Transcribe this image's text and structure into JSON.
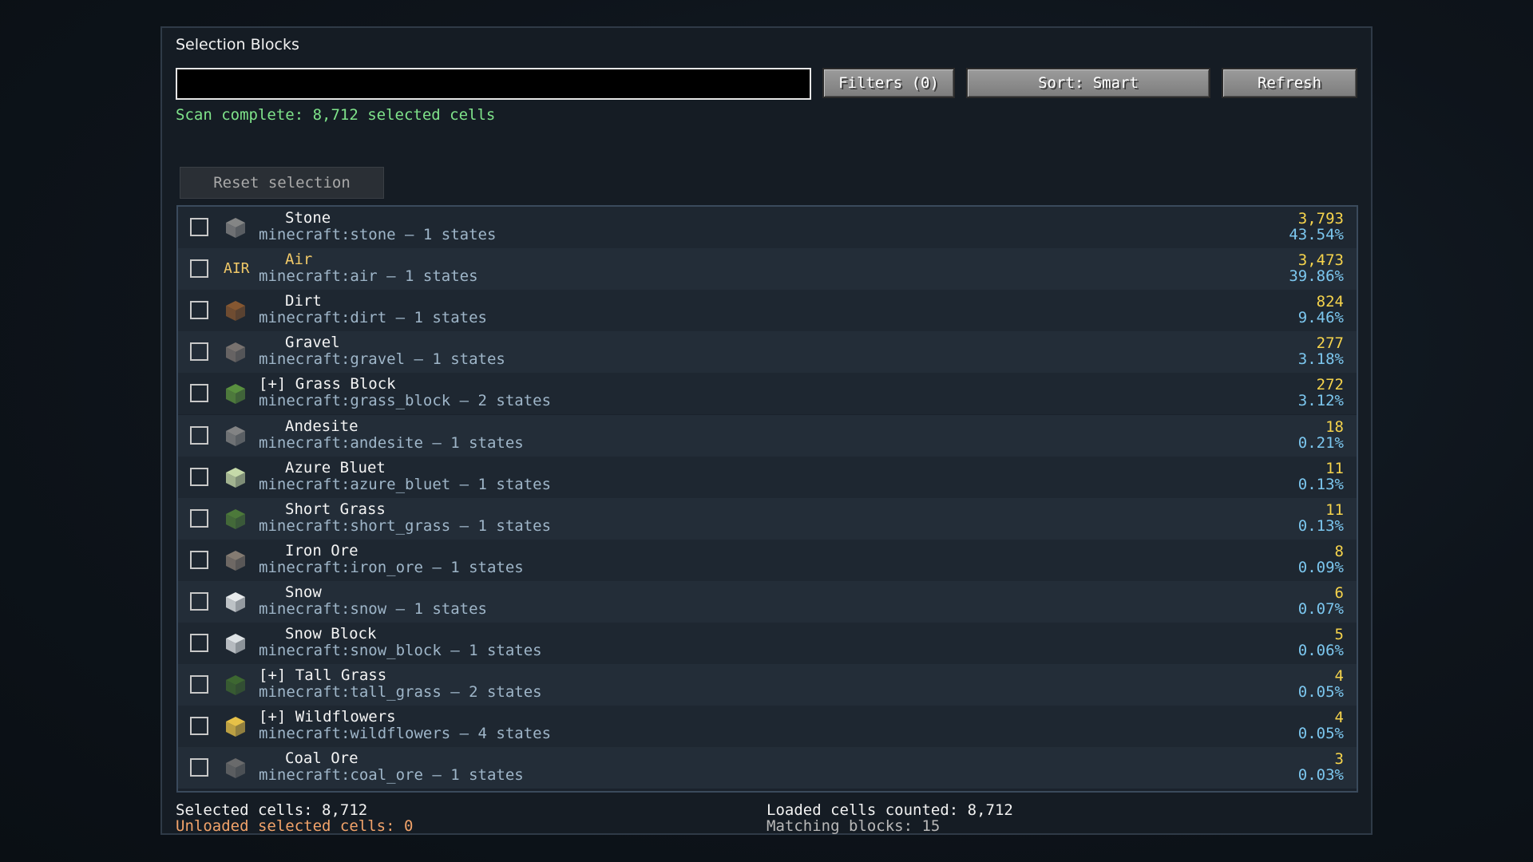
{
  "window": {
    "title": "Selection Blocks"
  },
  "search": {
    "value": "",
    "placeholder": ""
  },
  "toolbar": {
    "filters_label": "Filters (0)",
    "sort_label": "Sort: Smart",
    "refresh_label": "Refresh"
  },
  "status": {
    "text": "Scan complete: 8,712 selected cells"
  },
  "reset_label": "Reset selection",
  "rows": [
    {
      "name": "Stone",
      "sub": "minecraft:stone  –  1 states",
      "count": "3,793",
      "pct": "43.54%",
      "icon": "stone-icon",
      "color": "#8a8a8a"
    },
    {
      "name": "Air",
      "sub": "minecraft:air  –  1 states",
      "count": "3,473",
      "pct": "39.86%",
      "icon": "air-icon",
      "color": "#f1c968",
      "icon_text": "AIR"
    },
    {
      "name": "Dirt",
      "sub": "minecraft:dirt  –  1 states",
      "count": "824",
      "pct": "9.46%",
      "icon": "dirt-icon",
      "color": "#8b5a32"
    },
    {
      "name": "Gravel",
      "sub": "minecraft:gravel  –  1 states",
      "count": "277",
      "pct": "3.18%",
      "icon": "gravel-icon",
      "color": "#7d7672"
    },
    {
      "name": "[+] Grass Block",
      "sub": "minecraft:grass_block  –  2 states",
      "count": "272",
      "pct": "3.12%",
      "icon": "grass-block-icon",
      "color": "#5d9640"
    },
    {
      "name": "Andesite",
      "sub": "minecraft:andesite  –  1 states",
      "count": "18",
      "pct": "0.21%",
      "icon": "andesite-icon",
      "color": "#888888"
    },
    {
      "name": "Azure Bluet",
      "sub": "minecraft:azure_bluet  –  1 states",
      "count": "11",
      "pct": "0.13%",
      "icon": "azure-bluet-icon",
      "color": "#cfe3b0"
    },
    {
      "name": "Short Grass",
      "sub": "minecraft:short_grass  –  1 states",
      "count": "11",
      "pct": "0.13%",
      "icon": "short-grass-icon",
      "color": "#4f7d3a"
    },
    {
      "name": "Iron Ore",
      "sub": "minecraft:iron_ore  –  1 states",
      "count": "8",
      "pct": "0.09%",
      "icon": "iron-ore-icon",
      "color": "#8a7f76"
    },
    {
      "name": "Snow",
      "sub": "minecraft:snow  –  1 states",
      "count": "6",
      "pct": "0.07%",
      "icon": "snow-icon",
      "color": "#f2f4f6"
    },
    {
      "name": "Snow Block",
      "sub": "minecraft:snow_block  –  1 states",
      "count": "5",
      "pct": "0.06%",
      "icon": "snow-block-icon",
      "color": "#e8ecef"
    },
    {
      "name": "[+] Tall Grass",
      "sub": "minecraft:tall_grass  –  2 states",
      "count": "4",
      "pct": "0.05%",
      "icon": "tall-grass-icon",
      "color": "#3f6a30"
    },
    {
      "name": "[+] Wildflowers",
      "sub": "minecraft:wildflowers  –  4 states",
      "count": "4",
      "pct": "0.05%",
      "icon": "wildflowers-icon",
      "color": "#f1c94a"
    },
    {
      "name": "Coal Ore",
      "sub": "minecraft:coal_ore  –  1 states",
      "count": "3",
      "pct": "0.03%",
      "icon": "coal-ore-icon",
      "color": "#6e6e6e"
    }
  ],
  "footer": {
    "selected": "Selected cells: 8,712",
    "unloaded": "Unloaded selected cells: 0",
    "loaded": "Loaded cells counted: 8,712",
    "matching": "Matching blocks: 15"
  }
}
